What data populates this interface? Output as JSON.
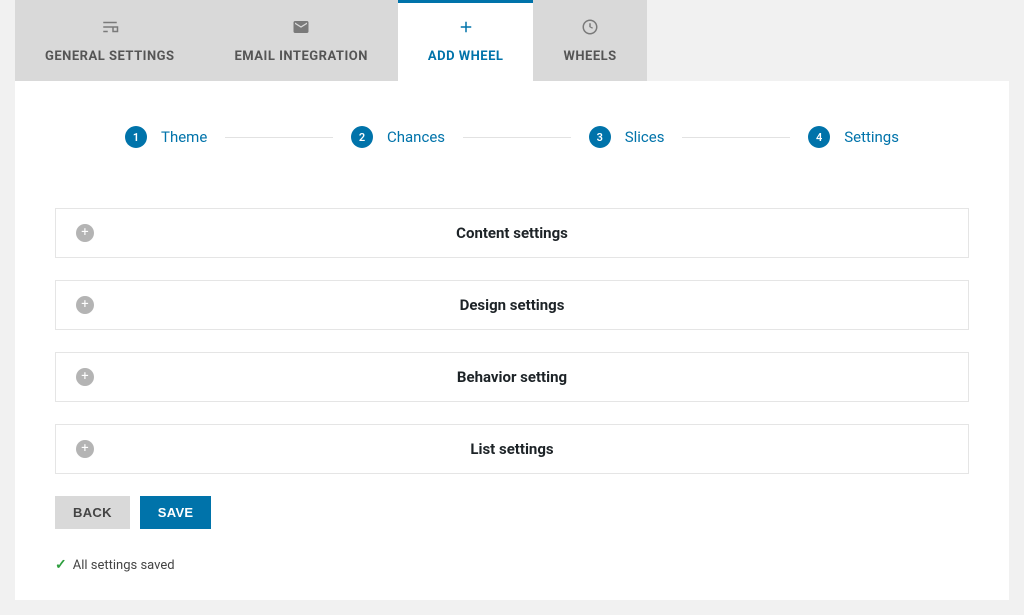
{
  "tabs": [
    {
      "label": "GENERAL SETTINGS",
      "icon": "⚙"
    },
    {
      "label": "EMAIL INTEGRATION",
      "icon": "✉"
    },
    {
      "label": "ADD WHEEL",
      "icon": "+"
    },
    {
      "label": "WHEELS",
      "icon": "⏱"
    }
  ],
  "steps": [
    {
      "num": "1",
      "label": "Theme"
    },
    {
      "num": "2",
      "label": "Chances"
    },
    {
      "num": "3",
      "label": "Slices"
    },
    {
      "num": "4",
      "label": "Settings"
    }
  ],
  "accordions": [
    {
      "title": "Content settings"
    },
    {
      "title": "Design settings"
    },
    {
      "title": "Behavior setting"
    },
    {
      "title": "List settings"
    }
  ],
  "buttons": {
    "back": "BACK",
    "save": "SAVE"
  },
  "status": {
    "message": "All settings saved"
  }
}
